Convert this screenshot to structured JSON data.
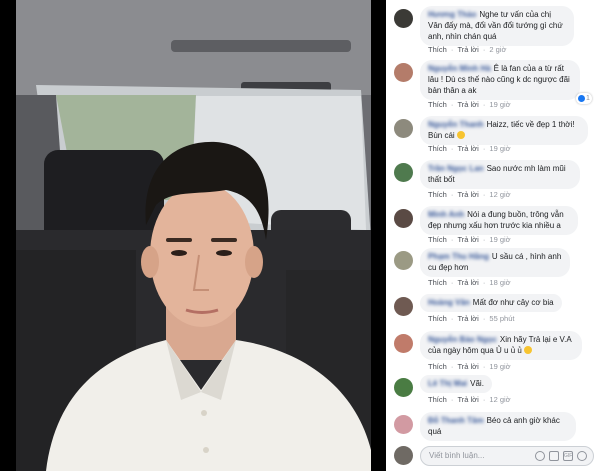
{
  "comments": [
    {
      "name": "Hương Thảo",
      "text": "Nghe tư vấn của chị Vân đấy mà, đổi vần đổi tướng gì chứ anh, nhìn chán quá",
      "like": "Thích",
      "reply": "Trả lời",
      "time": "2 giờ",
      "avatar_color": "#3b3a36",
      "reaction_count": ""
    },
    {
      "name": "Nguyễn Minh Hà",
      "text": "Ê là fan của a từ rất lâu ! Dù cs thế nào cũng k dc ngược đãi bản thân a ak",
      "like": "Thích",
      "reply": "Trả lời",
      "time": "19 giờ",
      "avatar_color": "#b47c6a",
      "reaction_count": "1"
    },
    {
      "name": "Nguyễn Thanh",
      "text": "Haizz, tiếc về đẹp 1 thời! Bùn cái",
      "like": "Thích",
      "reply": "Trả lời",
      "time": "19 giờ",
      "avatar_color": "#8d8a7d",
      "reaction_count": ""
    },
    {
      "name": "Trần Ngọc Lan",
      "text": "Sao nước mh làm mũi thất bốt",
      "like": "Thích",
      "reply": "Trả lời",
      "time": "12 giờ",
      "avatar_color": "#4f7a4e",
      "reaction_count": ""
    },
    {
      "name": "Minh Anh",
      "text": "Nói a đung buồn, trông vẫn đẹp nhưng xấu hơn trước kia nhiều a",
      "like": "Thích",
      "reply": "Trả lời",
      "time": "19 giờ",
      "avatar_color": "#5a4a44",
      "reaction_count": ""
    },
    {
      "name": "Phạm Thu Hằng",
      "text": "U sầu cá , hình anh cu đẹp hơn",
      "like": "Thích",
      "reply": "Trả lời",
      "time": "18 giờ",
      "avatar_color": "#9b9a84",
      "reaction_count": ""
    },
    {
      "name": "Hoàng Văn",
      "text": "Mất đơ như cây cơ bia",
      "like": "Thích",
      "reply": "Trả lời",
      "time": "55 phút",
      "avatar_color": "#6f5a52",
      "reaction_count": ""
    },
    {
      "name": "Nguyễn Bảo Ngọc",
      "text": "Xin hãy Trả lại e V.A của ngày hôm qua Ủ u ủ ủ",
      "like": "Thích",
      "reply": "Trả lời",
      "time": "19 giờ",
      "avatar_color": "#c07b6a",
      "reaction_count": ""
    },
    {
      "name": "Lê Thị Mai",
      "text": "Vãi.",
      "like": "Thích",
      "reply": "Trả lời",
      "time": "12 giờ",
      "avatar_color": "#4a7c43",
      "reaction_count": ""
    },
    {
      "name": "Đỗ Thanh Tâm",
      "text": "Béo cả anh giờ khác quá",
      "like": "Thích",
      "reply": "Trả lời",
      "time": "",
      "avatar_color": "#d29aa2",
      "reaction_count": ""
    }
  ],
  "composer": {
    "placeholder": "Viết bình luận..."
  },
  "colors": {
    "link": "#385898",
    "bubble": "#f2f3f5",
    "meta": "#90949c"
  }
}
